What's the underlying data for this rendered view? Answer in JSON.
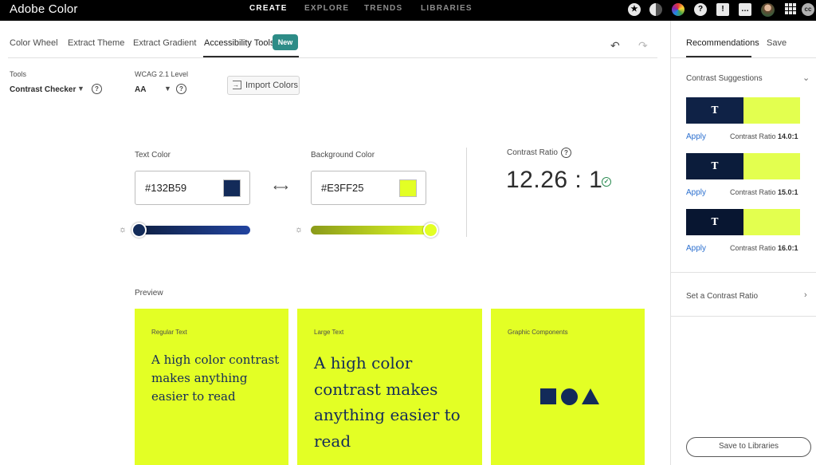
{
  "app": {
    "title": "Adobe Color"
  },
  "topnav": {
    "items": [
      "CREATE",
      "EXPLORE",
      "TRENDS",
      "LIBRARIES"
    ],
    "active": "CREATE"
  },
  "tabs": {
    "items": [
      "Color Wheel",
      "Extract Theme",
      "Extract Gradient",
      "Accessibility Tools"
    ],
    "active": "Accessibility Tools",
    "new_badge": "New"
  },
  "tools": {
    "tools_label": "Tools",
    "tool_value": "Contrast Checker",
    "wcag_label": "WCAG 2.1 Level",
    "wcag_value": "AA",
    "import_label": "Import Colors"
  },
  "contrast": {
    "text_color_label": "Text Color",
    "text_color_value": "#132B59",
    "background_color_label": "Background Color",
    "background_color_value": "#E3FF25",
    "ratio_label": "Contrast Ratio",
    "ratio_value": "12.26 : 1",
    "text_slider_level": 0.0,
    "background_slider_level": 1.0
  },
  "preview": {
    "label": "Preview",
    "cards": [
      {
        "label": "Regular Text",
        "text": [
          "A high color contrast",
          "makes anything",
          "easier to read"
        ]
      },
      {
        "label": "Large Text",
        "text": [
          "A high color",
          "contrast makes",
          "anything easier to",
          "read"
        ]
      },
      {
        "label": "Graphic Components",
        "shapes": [
          "square",
          "circle",
          "triangle"
        ]
      }
    ]
  },
  "panel": {
    "tabs": [
      "Recommendations",
      "Save"
    ],
    "active_tab": "Recommendations",
    "suggestions_heading": "Contrast Suggestions",
    "suggestions": [
      {
        "apply_label": "Apply",
        "ratio_label": "Contrast Ratio",
        "ratio_value": "14.0:1",
        "sample_letter": "T",
        "text_color": "#0f2246",
        "bg_color": "#e3ff4f"
      },
      {
        "apply_label": "Apply",
        "ratio_label": "Contrast Ratio",
        "ratio_value": "15.0:1",
        "sample_letter": "T",
        "text_color": "#0b1c3b",
        "bg_color": "#e3ff4f"
      },
      {
        "apply_label": "Apply",
        "ratio_label": "Contrast Ratio",
        "ratio_value": "16.0:1",
        "sample_letter": "T",
        "text_color": "#081631",
        "bg_color": "#e3ff4f"
      }
    ],
    "set_ratio_label": "Set a Contrast Ratio",
    "save_button": "Save to Libraries"
  },
  "colors": {
    "accent": "#2d8c87",
    "text_color": "#132B59",
    "background_color": "#E3FF25",
    "link": "#2b6fcf",
    "topbar": "#000000"
  },
  "icons": {
    "topbar": [
      "star-icon",
      "theme-toggle-icon",
      "color-wheel-icon",
      "help-icon",
      "feedback-icon",
      "chat-icon",
      "avatar",
      "app-grid-icon",
      "creative-cloud-icon"
    ],
    "undo": "undo-icon",
    "redo": "redo-icon",
    "swap": "swap-icon",
    "brightness": "brightness-icon",
    "check": "check-circle-icon"
  }
}
